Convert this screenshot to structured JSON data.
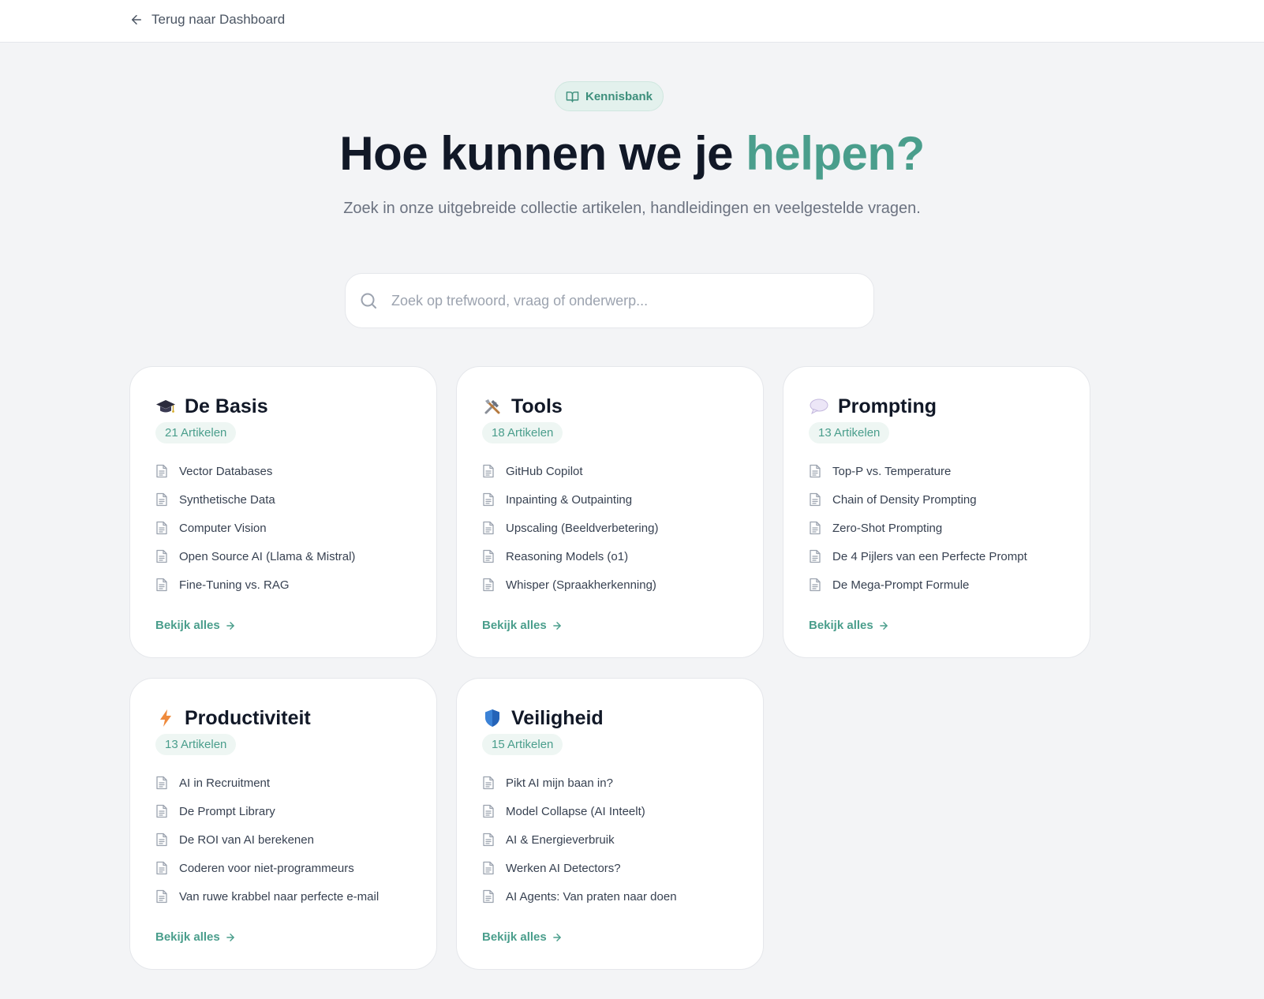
{
  "nav": {
    "back_label": "Terug naar Dashboard"
  },
  "hero": {
    "badge_label": "Kennisbank",
    "title_main": "Hoe kunnen we je ",
    "title_accent": "helpen?",
    "subtitle": "Zoek in onze uitgebreide collectie artikelen, handleidingen en veelgestelde vragen.",
    "search_placeholder": "Zoek op trefwoord, vraag of onderwerp..."
  },
  "colors": {
    "accent": "#4a9e8c",
    "badge_bg": "#e3f1ed",
    "page_bg": "#f3f4f6"
  },
  "categories": [
    {
      "icon": "graduation-cap-icon",
      "title": "De Basis",
      "count": "21 Artikelen",
      "articles": [
        "Vector Databases",
        "Synthetische Data",
        "Computer Vision",
        "Open Source AI (Llama & Mistral)",
        "Fine-Tuning vs. RAG"
      ],
      "see_all": "Bekijk alles"
    },
    {
      "icon": "tools-icon",
      "title": "Tools",
      "count": "18 Artikelen",
      "articles": [
        "GitHub Copilot",
        "Inpainting & Outpainting",
        "Upscaling (Beeldverbetering)",
        "Reasoning Models (o1)",
        "Whisper (Spraakherkenning)"
      ],
      "see_all": "Bekijk alles"
    },
    {
      "icon": "speech-bubble-icon",
      "title": "Prompting",
      "count": "13 Artikelen",
      "articles": [
        "Top-P vs. Temperature",
        "Chain of Density Prompting",
        "Zero-Shot Prompting",
        "De 4 Pijlers van een Perfecte Prompt",
        "De Mega-Prompt Formule"
      ],
      "see_all": "Bekijk alles"
    },
    {
      "icon": "lightning-icon",
      "title": "Productiviteit",
      "count": "13 Artikelen",
      "articles": [
        "AI in Recruitment",
        "De Prompt Library",
        "De ROI van AI berekenen",
        "Coderen voor niet-programmeurs",
        "Van ruwe krabbel naar perfecte e-mail"
      ],
      "see_all": "Bekijk alles"
    },
    {
      "icon": "shield-icon",
      "title": "Veiligheid",
      "count": "15 Artikelen",
      "articles": [
        "Pikt AI mijn baan in?",
        "Model Collapse (AI Inteelt)",
        "AI & Energieverbruik",
        "Werken AI Detectors?",
        "AI Agents: Van praten naar doen"
      ],
      "see_all": "Bekijk alles"
    }
  ]
}
